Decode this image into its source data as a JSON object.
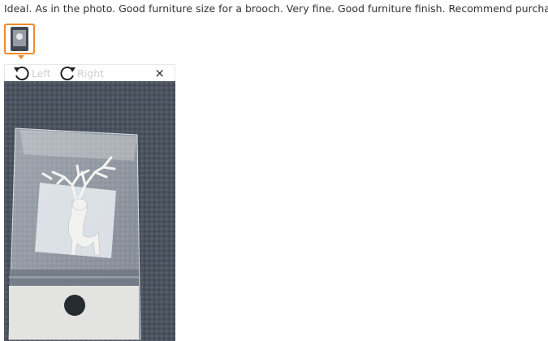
{
  "review": {
    "text": "Ideal. As in the photo. Good furniture size for a brooch. Very fine. Good furniture finish. Recommend purchase."
  },
  "thumbnails": [
    {
      "icon": "photo-thumbnail",
      "selected": true
    }
  ],
  "viewer": {
    "rotate_left_label": "Left",
    "rotate_right_label": "Right",
    "close_symbol": "×",
    "rotate_left_icon": "rotate-left-icon",
    "rotate_right_icon": "rotate-right-icon",
    "close_icon": "close-icon",
    "photo_subject": "deer brooch in plastic bag on dark fabric"
  },
  "colors": {
    "accent": "#f08a2c",
    "text": "#333333",
    "disabled_label": "#cfcfcf"
  }
}
